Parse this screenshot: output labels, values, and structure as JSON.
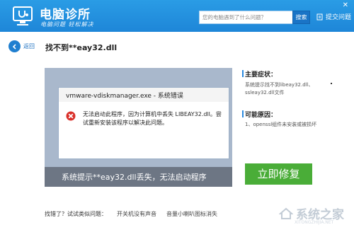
{
  "header": {
    "app_title": "电脑诊所",
    "slogan": "电脑问题 轻松解决",
    "search_placeholder": "您的电脑遇到了什么问题？",
    "search_button": "搜索",
    "submit_issue": "提交问题",
    "close_glyph": "✕",
    "brand_color": "#1e86d8"
  },
  "nav": {
    "back_label": "返回",
    "page_title": "找不到**eay32.dll"
  },
  "screenshot": {
    "dialog_title": "vmware-vdiskmanager.exe - 系统错误",
    "dialog_message": "无法启动此程序，因为计算机中丢失 LIBEAY32.dll。尝试重新安装该程序以解决此问题。",
    "caption": "系统提示**eay32.dll丢失，无法启动程序"
  },
  "sidebar": {
    "symptoms_heading": "主要症状：",
    "symptoms_text": "系统提示找不到libeay32.dll、ssleay32.dll文件",
    "cause_heading": "可能原因：",
    "cause_text": "1、openssl组件未安装或被损坏"
  },
  "fix_button": "立即修复",
  "fix_color": "#4aad38",
  "related": {
    "label": "找错了？试试类似问题：",
    "items": [
      "开关机没有声音",
      "音量小喇叭图标消失"
    ]
  },
  "watermark": {
    "text": "系统之家",
    "sub": "XITONGZHIJIA.NET"
  }
}
